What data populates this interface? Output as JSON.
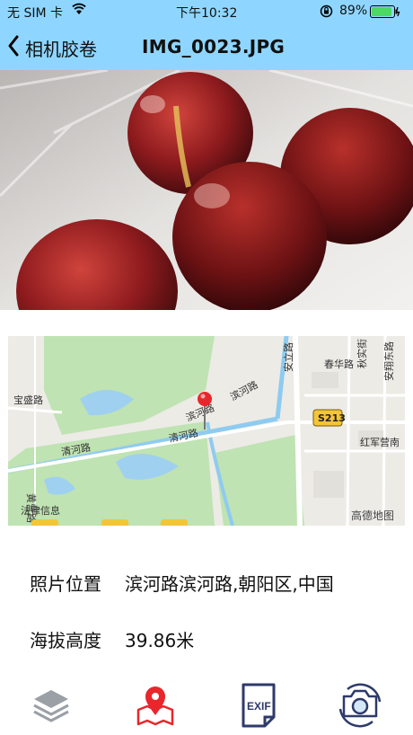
{
  "status_bar": {
    "carrier": "无 SIM 卡",
    "time": "下午10:32",
    "battery": "89%"
  },
  "nav": {
    "back_label": "相机胶卷",
    "title": "IMG_0023.JPG"
  },
  "map": {
    "labels": {
      "road1": "清河路",
      "road2": "清河路",
      "binhe": "滨河路",
      "binhe2": "滨河路",
      "anli": "安立路",
      "chunhua": "春华路",
      "baosheng": "宝盛路",
      "huangying": "黄营路",
      "s213": "S213",
      "hongjun": "红军营南",
      "qiujia": "秋实街",
      "anxiang": "安翔东路",
      "legal": "法律信息",
      "brand": "高德地图"
    }
  },
  "info": {
    "location_label": "照片位置",
    "location_value": "滨河路滨河路,朝阳区,中国",
    "altitude_label": "海拔高度",
    "altitude_value": "39.86米"
  },
  "colors": {
    "nav_bg": "#8ed6ff",
    "battery": "#4cd964",
    "pin": "#e8262b"
  }
}
